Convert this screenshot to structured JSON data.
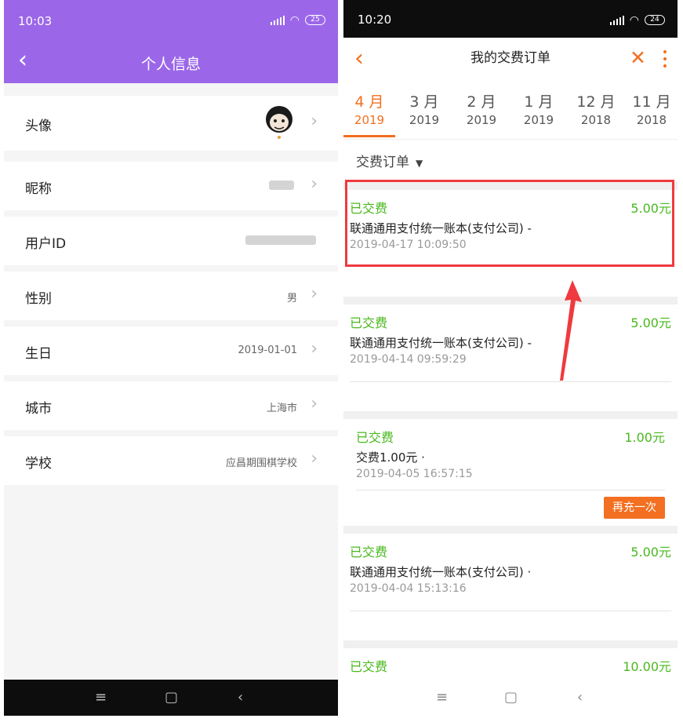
{
  "left_screen": {
    "status_time": "10:03",
    "battery": "25",
    "back_glyph": "‹",
    "title": "个人信息",
    "rows": [
      {
        "label": "头像",
        "value": ""
      },
      {
        "label": "昵称",
        "value": ""
      },
      {
        "label": "用户ID",
        "value": ""
      },
      {
        "label": "性别",
        "value": "男"
      },
      {
        "label": "生日",
        "value": "2019-01-01"
      },
      {
        "label": "城市",
        "value": "上海市"
      },
      {
        "label": "学校",
        "value": "应昌期围棋学校"
      }
    ],
    "nav_buttons": [
      "≡",
      "▢",
      "‹"
    ]
  },
  "right_screen": {
    "status_time": "10:20",
    "battery": "24",
    "back_glyph": "‹",
    "title": "我的交费订单",
    "close_glyph": "✕",
    "tabs": [
      {
        "month": "4 月",
        "year": "2019"
      },
      {
        "month": "3 月",
        "year": "2019"
      },
      {
        "month": "2 月",
        "year": "2019"
      },
      {
        "month": "1 月",
        "year": "2019"
      },
      {
        "month": "12 月",
        "year": "2018"
      },
      {
        "month": "11 月",
        "year": "2018"
      }
    ],
    "filter_label": "交费订单",
    "filter_triangle": "▼",
    "orders": [
      {
        "status": "已交费",
        "amount": "5.00元",
        "desc": "联通通用支付统一账本(支付公司) -",
        "date": "2019-04-17 10:09:50"
      },
      {
        "status": "已交费",
        "amount": "5.00元",
        "desc": "联通通用支付统一账本(支付公司) -",
        "date": "2019-04-14 09:59:29"
      },
      {
        "status": "已交费",
        "amount": "1.00元",
        "desc": "交费1.00元 ·",
        "date": "2019-04-05 16:57:15"
      },
      {
        "status": "已交费",
        "amount": "5.00元",
        "desc": "联通通用支付统一账本(支付公司) ·",
        "date": "2019-04-04 15:13:16"
      },
      {
        "status": "已交费",
        "amount": "10.00元",
        "desc": "",
        "date": ""
      }
    ],
    "recharge_button": "再充一次",
    "nav_buttons": [
      "≡",
      "▢",
      "‹"
    ]
  },
  "colors": {
    "left_header": "#9b67e8",
    "accent_orange": "#f36f21",
    "paid_green": "#49b81e",
    "annotation_red": "#ef3a3f"
  }
}
